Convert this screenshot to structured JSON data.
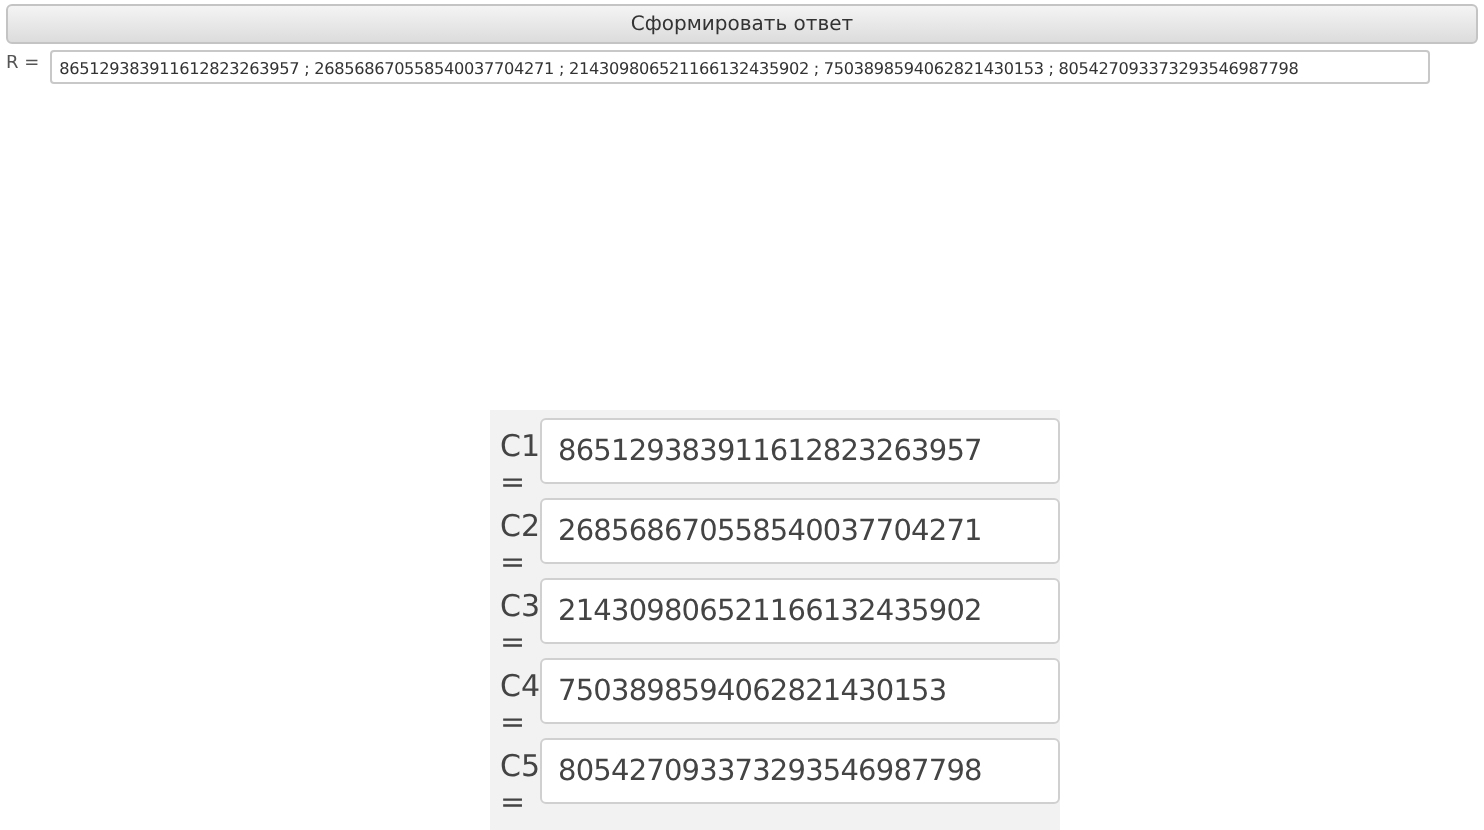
{
  "generate_button": {
    "label": "Сформировать ответ"
  },
  "result": {
    "label": "R =",
    "value": "865129383911612823263957 ; 268568670558540037704271 ; 214309806521166132435902 ; 750389859406282143015​3 ; 805427093373293546987798"
  },
  "fields": [
    {
      "label": "C1 =",
      "value": "865129383911612823263957"
    },
    {
      "label": "C2 =",
      "value": "268568670558540037704271"
    },
    {
      "label": "C3 =",
      "value": "214309806521166132435902"
    },
    {
      "label": "C4 =",
      "value": "7503898594062821430153"
    },
    {
      "label": "C5 =",
      "value": "805427093373293546987798"
    }
  ]
}
